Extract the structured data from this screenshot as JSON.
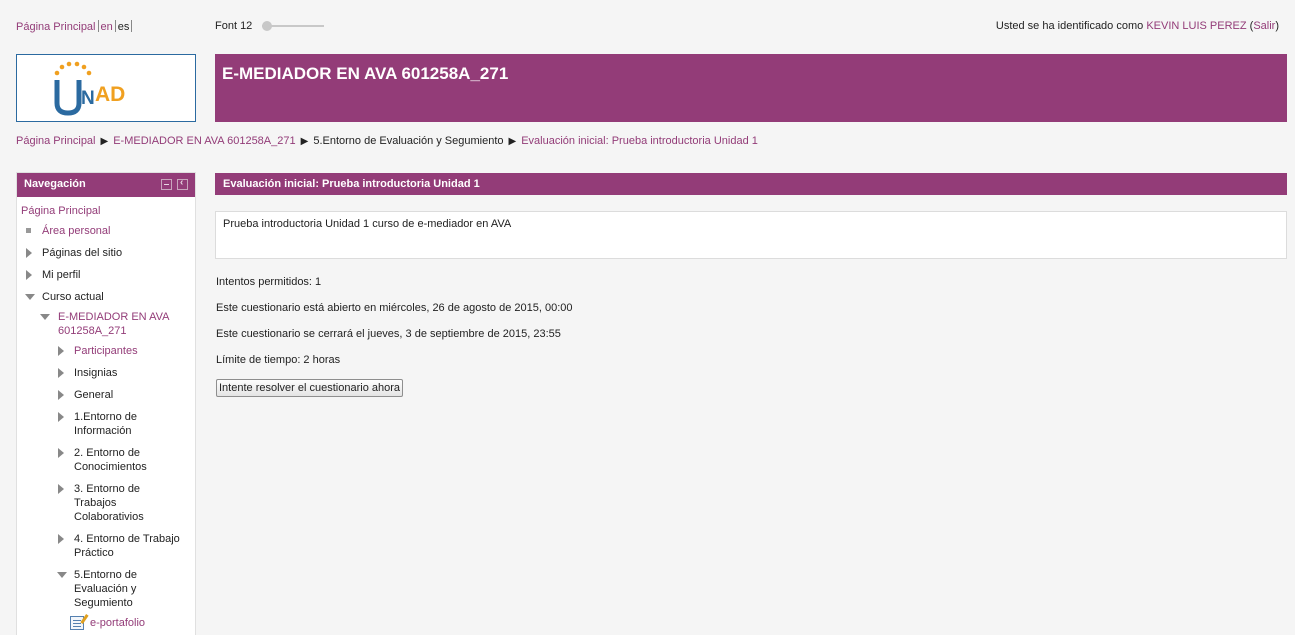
{
  "topbar": {
    "home_link": "Página Principal",
    "lang_en": "en",
    "lang_es": "es",
    "font_label": "Font 12",
    "login_prefix": "Usted se ha identificado como ",
    "user_name": "KEVIN LUIS PEREZ",
    "logout_open": " (",
    "logout_label": "Salir",
    "logout_close": ")"
  },
  "header": {
    "logo_text": "UNAD",
    "course_title": "E-MEDIADOR EN AVA 601258A_271"
  },
  "breadcrumb": [
    "Página Principal",
    "E-MEDIADOR EN AVA 601258A_271",
    "5.Entorno de Evaluación y Segumiento",
    "Evaluación inicial: Prueba introductoria Unidad 1"
  ],
  "navigation": {
    "title": "Navegación",
    "home": "Página Principal",
    "area_personal": "Área personal",
    "site_pages": "Páginas del sitio",
    "my_profile": "Mi perfil",
    "current_course": "Curso actual",
    "course_line1": "E-MEDIADOR EN AVA",
    "course_line2": "601258A_271",
    "participants": "Participantes",
    "badges": "Insignias",
    "general": "General",
    "env1_l1": "1.Entorno de",
    "env1_l2": "Información",
    "env2_l1": "2. Entorno de",
    "env2_l2": "Conocimientos",
    "env3_l1": "3. Entorno de",
    "env3_l2": "Trabajos",
    "env3_l3": "Colaborativios",
    "env4_l1": "4. Entorno de Trabajo",
    "env4_l2": "Práctico",
    "env5_l1": "5.Entorno de",
    "env5_l2": "Evaluación y",
    "env5_l3": "Segumiento",
    "eportfolio": "e-portafolio"
  },
  "quiz": {
    "heading": "Evaluación inicial: Prueba introductoria Unidad 1",
    "intro": "Prueba introductoria Unidad 1 curso de e-mediador en AVA",
    "attempts": "Intentos permitidos: 1",
    "opened": "Este cuestionario está abierto en miércoles, 26 de agosto de 2015, 00:00",
    "closes": "Este cuestionario se cerrará el jueves, 3 de septiembre de 2015, 23:55",
    "time_limit": "Límite de tiempo: 2 horas",
    "attempt_button": "Intente resolver el cuestionario ahora"
  },
  "colors": {
    "brand": "#933c78",
    "logo_blue": "#2b6aa0",
    "logo_orange": "#f0a020"
  }
}
